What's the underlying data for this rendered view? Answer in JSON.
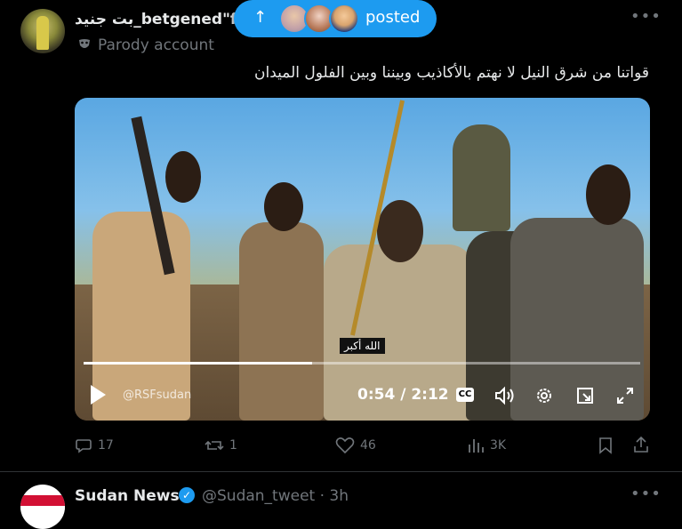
{
  "post": {
    "author_name": "بت جنيد_betgened\"fa",
    "author_badge": "Parody account",
    "text": "قواتنا من شرق النيل لا نهتم بالأكاذيب وبيننا وبين الفلول  الميدان",
    "more_icon": "•••"
  },
  "posted_pill": {
    "arrow": "↑",
    "label": "posted"
  },
  "video": {
    "caption": "الله أكبر",
    "watermark": "@RSFsudan",
    "time": "0:54 / 2:12",
    "progress": 0.41,
    "cc_label": "CC"
  },
  "actions": {
    "replies": "17",
    "reposts": "1",
    "likes": "46",
    "views": "3K"
  },
  "next_post": {
    "author_name": "Sudan News",
    "handle_time": "@Sudan_tweet · 3h",
    "more_icon": "•••"
  },
  "colors": {
    "accent": "#1d9bf0",
    "muted": "#71767b",
    "text": "#e7e9ea",
    "background": "#000000"
  }
}
